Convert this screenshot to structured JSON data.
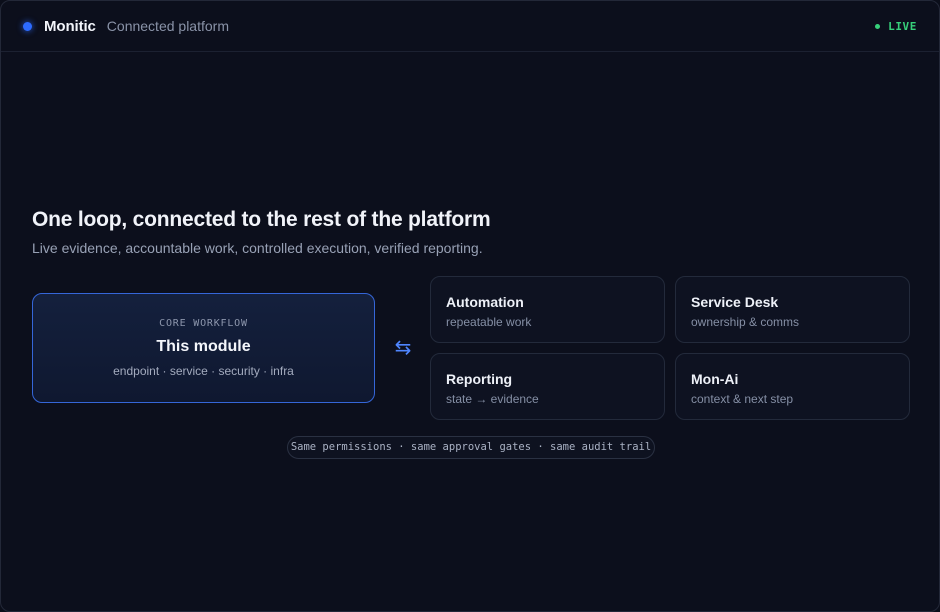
{
  "header": {
    "brand": "Monitic",
    "subtitle": "Connected platform",
    "status": "LIVE",
    "brand_color": "#2d6bff",
    "status_color": "#37d07a"
  },
  "main": {
    "headline": "One loop, connected to the rest of the platform",
    "subheadline": "Live evidence, accountable work, controlled execution, verified reporting.",
    "core": {
      "eyebrow": "CORE WORKFLOW",
      "title": "This module",
      "tags": "endpoint · service · security · infra"
    },
    "connector_icon": "bidirectional-arrows-icon",
    "connector_glyph": "⇆",
    "tiles": [
      {
        "title": "Automation",
        "desc": "repeatable work"
      },
      {
        "title": "Service Desk",
        "desc": "ownership & comms"
      },
      {
        "title": "Reporting",
        "desc": "state → evidence"
      },
      {
        "title": "Mon-Ai",
        "desc": "context & next step"
      }
    ],
    "footer_note": "Same permissions · same approval gates · same audit trail"
  }
}
